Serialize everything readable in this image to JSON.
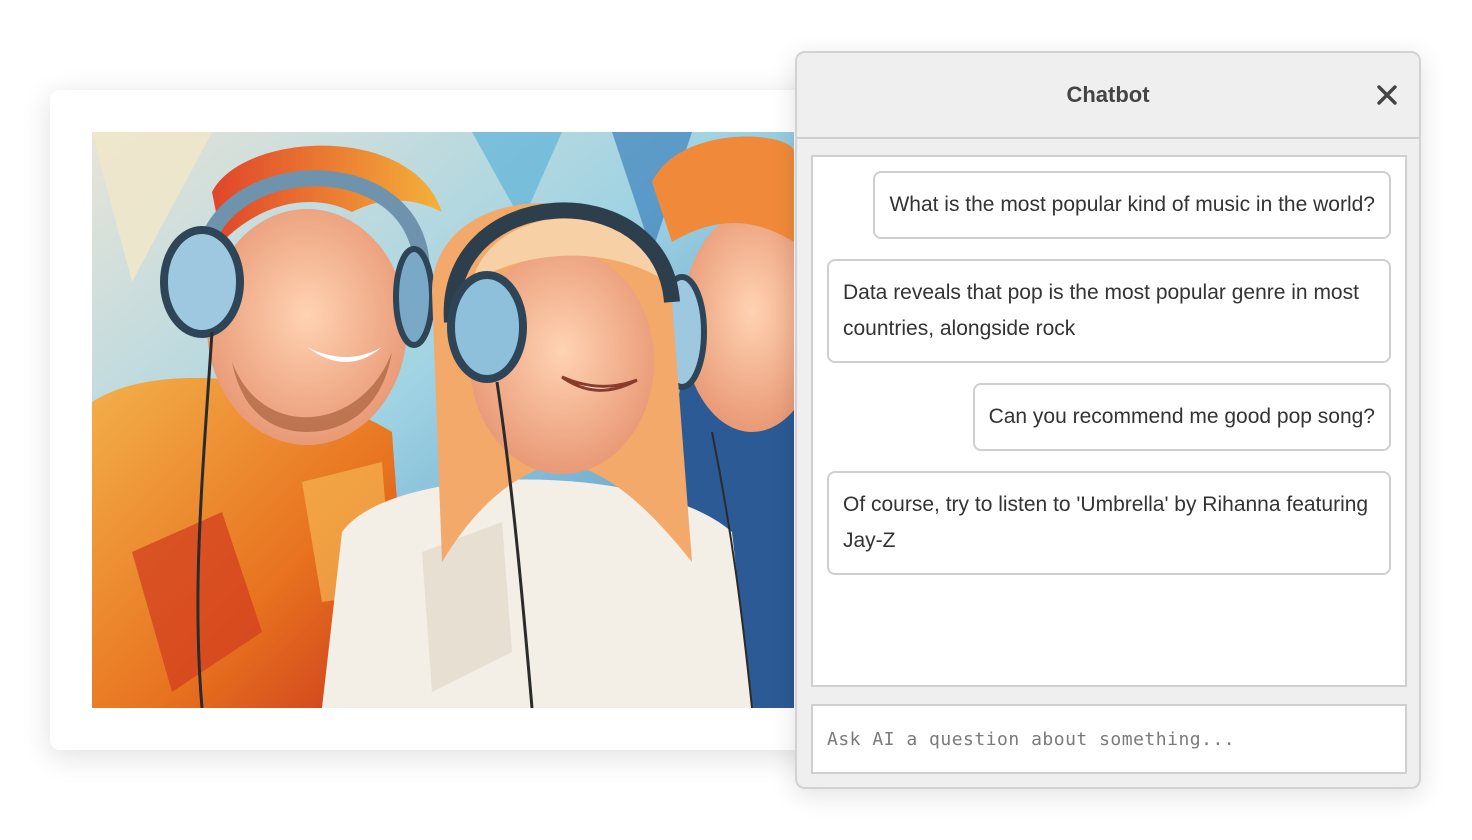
{
  "chat": {
    "title": "Chatbot",
    "messages": [
      {
        "role": "user",
        "text": "What is the most popular kind of music in the world?"
      },
      {
        "role": "bot",
        "text": "Data reveals that pop is the most popular genre in most countries, alongside rock"
      },
      {
        "role": "user",
        "text": "Can you recommend me good pop song?"
      },
      {
        "role": "bot",
        "text": "Of course, try to listen to 'Umbrella' by Rihanna featuring Jay-Z"
      }
    ],
    "input": {
      "placeholder": "Ask AI a question about something...",
      "value": ""
    }
  },
  "icons": {
    "close": "close-icon"
  },
  "colors": {
    "panel_bg": "#efefef",
    "border": "#cfcfcf",
    "text": "#333333"
  }
}
